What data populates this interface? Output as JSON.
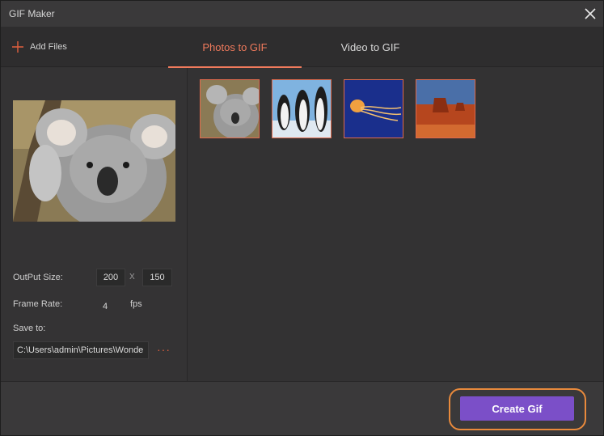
{
  "window": {
    "title": "GIF Maker",
    "close_icon": "close-icon"
  },
  "toolbar": {
    "add_files_label": "Add Files",
    "add_icon": "plus-icon",
    "tabs": [
      {
        "label": "Photos to GIF",
        "active": true
      },
      {
        "label": "Video to GIF",
        "active": false
      }
    ],
    "accent_color": "#f07a5c"
  },
  "settings": {
    "output_size_label": "OutPut Size:",
    "width": "200",
    "separator": "X",
    "height": "150",
    "frame_rate_label": "Frame Rate:",
    "frame_rate": "4",
    "fps_unit": "fps",
    "save_to_label": "Save to:",
    "save_path": "C:\\Users\\admin\\Pictures\\Wonde",
    "browse_label": "···"
  },
  "preview": {
    "subject": "koala"
  },
  "thumbnails": [
    {
      "subject": "koala"
    },
    {
      "subject": "penguins"
    },
    {
      "subject": "jellyfish"
    },
    {
      "subject": "desert"
    }
  ],
  "footer": {
    "create_label": "Create Gif",
    "button_color": "#7b4fc8",
    "highlight_color": "#e98a3c"
  }
}
